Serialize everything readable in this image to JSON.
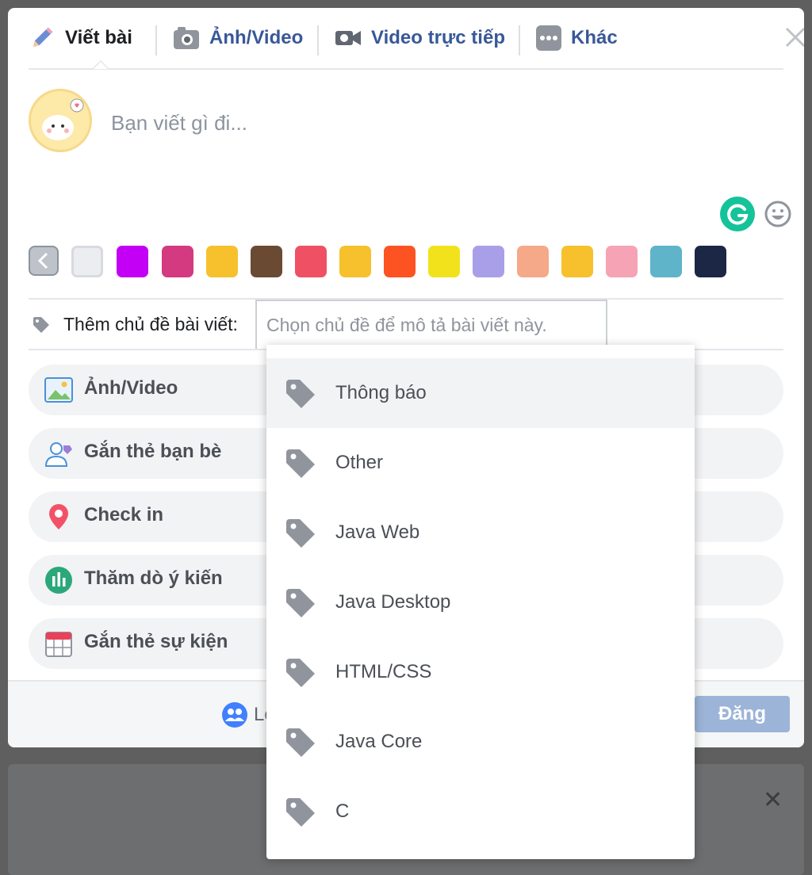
{
  "composer": {
    "tabs": [
      {
        "label": "Viết bài",
        "icon": "pencil-icon"
      },
      {
        "label": "Ảnh/Video",
        "icon": "camera-icon"
      },
      {
        "label": "Video trực tiếp",
        "icon": "video-camera-icon"
      },
      {
        "label": "Khác",
        "icon": "more-dots-icon"
      }
    ],
    "post_placeholder": "Bạn viết gì đi...",
    "background_swatches": [
      "#ebedf0",
      "#c300f5",
      "#d43a7f",
      "#f6c12d",
      "#6a4a33",
      "#ef5064",
      "#f6c12d",
      "#fd5322",
      "#f2e21c",
      "#a89fe8",
      "#f6a988",
      "#f6c12d",
      "#f5a3b5",
      "#5fb4c9",
      "#1b2744"
    ],
    "topic": {
      "label": "Thêm chủ đề bài viết:",
      "placeholder": "Chọn chủ đề để mô tả bài viết này."
    },
    "options": [
      {
        "label": "Ảnh/Video",
        "icon": "photo-icon"
      },
      {
        "label": "Gắn thẻ bạn bè",
        "icon": "tag-friends-icon"
      },
      {
        "label": "Check in",
        "icon": "location-pin-icon"
      },
      {
        "label": "Thăm dò ý kiến",
        "icon": "poll-icon"
      },
      {
        "label": "Gắn thẻ sự kiện",
        "icon": "calendar-icon"
      }
    ],
    "footer": {
      "audience_partial": "Lo",
      "post_button": "Đăng"
    }
  },
  "dropdown": {
    "items": [
      "Thông báo",
      "Other",
      "Java Web",
      "Java Desktop",
      "HTML/CSS",
      "Java Core",
      "C"
    ],
    "highlighted_index": 0
  },
  "colors": {
    "accent": "#385898",
    "grammarly": "#15c39a",
    "post_button_disabled": "#9cb4d8"
  }
}
